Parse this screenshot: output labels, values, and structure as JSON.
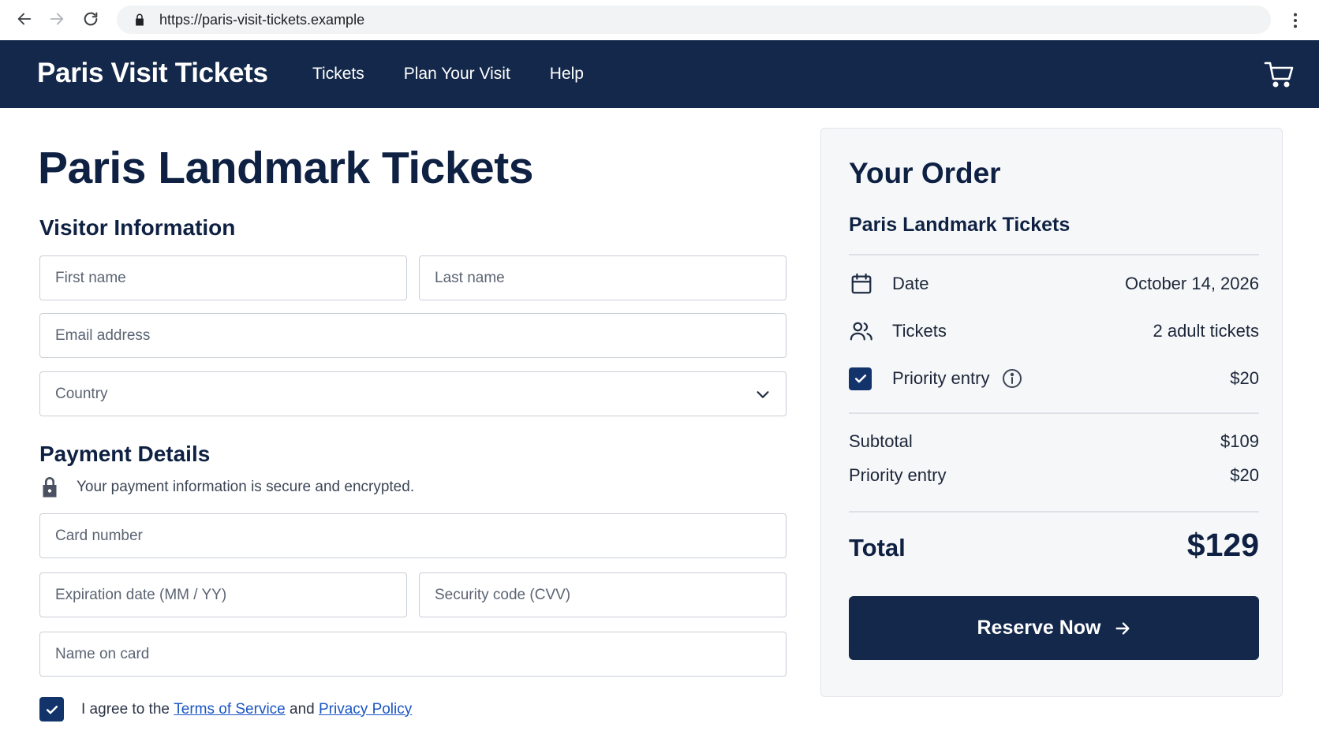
{
  "browser": {
    "url": "https://paris-visit-tickets.example"
  },
  "header": {
    "brand": "Paris Visit Tickets",
    "nav": [
      "Tickets",
      "Plan Your Visit",
      "Help"
    ]
  },
  "main": {
    "title": "Paris Landmark Tickets",
    "visitor_section": "Visitor Information",
    "first_name_placeholder": "First name",
    "last_name_placeholder": "Last name",
    "email_placeholder": "Email address",
    "country_placeholder": "Country",
    "payment_section": "Payment Details",
    "secure_note": "Your payment information is secure and encrypted.",
    "card_number_placeholder": "Card number",
    "expiration_placeholder": "Expiration date (MM / YY)",
    "cvv_placeholder": "Security code (CVV)",
    "name_on_card_placeholder": "Name on card",
    "agree_checked": true,
    "agree_prefix": "I agree to the ",
    "terms_link": "Terms of Service",
    "agree_and": " and ",
    "privacy_link": "Privacy Policy"
  },
  "order": {
    "title": "Your Order",
    "product": "Paris Landmark Tickets",
    "date_label": "Date",
    "date_value": "October 14, 2026",
    "tickets_label": "Tickets",
    "tickets_value": "2 adult tickets",
    "priority_checked": true,
    "priority_label": "Priority entry",
    "priority_value": "$20",
    "subtotal_label": "Subtotal",
    "subtotal_value": "$109",
    "priority_line_label": "Priority entry",
    "priority_line_value": "$20",
    "total_label": "Total",
    "total_value": "$129",
    "reserve_label": "Reserve Now"
  },
  "colors": {
    "header_bg": "#13284a",
    "primary": "#13284a",
    "checkbox": "#13346b",
    "link": "#1a56c4",
    "panel_bg": "#f6f7f9"
  }
}
